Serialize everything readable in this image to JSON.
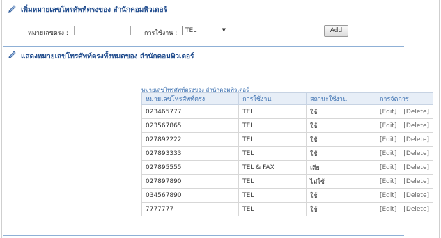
{
  "add_section": {
    "title": "เพิ่มหมายเลขโทรศัพท์ตรงของ สำนักคอมพิวเตอร์",
    "phone_label": "หมายเลขตรง :",
    "phone_value": "",
    "usage_label": "การใช้งาน :",
    "usage_selected": "TEL",
    "add_button": "Add"
  },
  "list_section": {
    "title": "แสดงหมายเลขโทรศัพท์ตรงทั้งหมดของ สำนักคอมพิวเตอร์",
    "caption": "หมายเลขโทรศัพท์ตรงของ สำนักคอมพิวเตอร์",
    "headers": [
      "หมายเลขโทรศัพท์ตรง",
      "การใช้งาน",
      "สถานะใช้งาน",
      "การจัดการ"
    ],
    "rows": [
      {
        "number": "023465777",
        "usage": "TEL",
        "status": "ใช้"
      },
      {
        "number": "023567865",
        "usage": "TEL",
        "status": "ใช้"
      },
      {
        "number": "027892222",
        "usage": "TEL",
        "status": "ใช้"
      },
      {
        "number": "027893333",
        "usage": "TEL",
        "status": "ใช้"
      },
      {
        "number": "027895555",
        "usage": "TEL & FAX",
        "status": "เสีย"
      },
      {
        "number": "027897890",
        "usage": "TEL",
        "status": "ไม่ใช้"
      },
      {
        "number": "034567890",
        "usage": "TEL",
        "status": "ใช้"
      },
      {
        "number": "7777777",
        "usage": "TEL",
        "status": "ใช้"
      }
    ],
    "edit_label": "[Edit]",
    "delete_label": "[Delete]"
  },
  "icons": {
    "section": "pen-icon"
  },
  "colors": {
    "title": "#1e4a8c",
    "header_bg": "#e7eef7",
    "link": "#3a6fb0"
  }
}
